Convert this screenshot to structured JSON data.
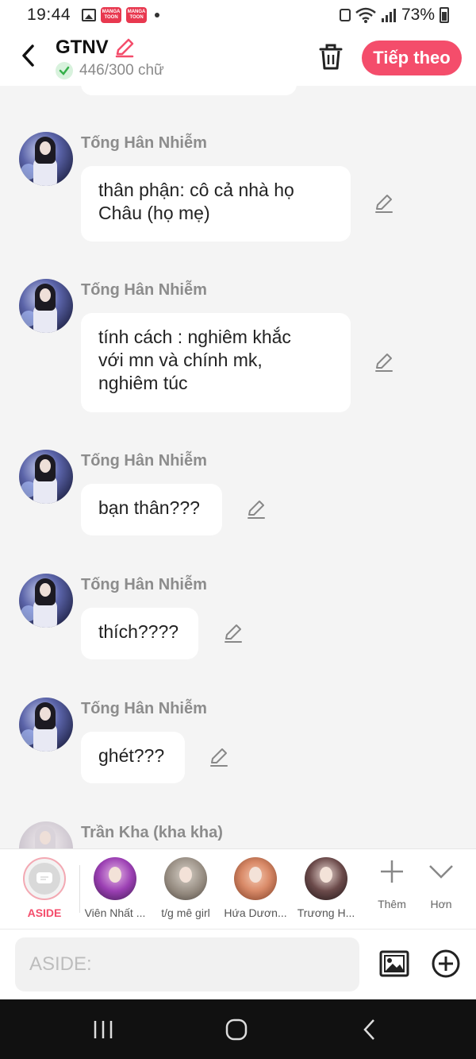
{
  "status_bar": {
    "time": "19:44",
    "battery": "73%",
    "manga_badge": "MANGA TOON"
  },
  "header": {
    "title": "GTNV",
    "word_count": "446/300 chữ",
    "next_label": "Tiếp theo"
  },
  "messages": [
    {
      "name": "Tống Hân Nhiễm",
      "lines": [
        "thân phận: cô cả nhà họ",
        "Châu (họ mẹ)"
      ]
    },
    {
      "name": "Tống Hân Nhiễm",
      "lines": [
        "tính cách : nghiêm khắc",
        "với mn và chính mk,",
        "nghiêm túc"
      ]
    },
    {
      "name": "Tống Hân Nhiễm",
      "lines": [
        "bạn thân???"
      ]
    },
    {
      "name": "Tống Hân Nhiễm",
      "lines": [
        "thích????"
      ]
    },
    {
      "name": "Tống Hân Nhiễm",
      "lines": [
        "ghét???"
      ]
    },
    {
      "name": "Trần Kha (kha kha)",
      "lines": []
    }
  ],
  "characters": [
    {
      "label": "ASIDE"
    },
    {
      "label": "Viên Nhất ..."
    },
    {
      "label": "t/g mê girl"
    },
    {
      "label": "Hứa Dươn..."
    },
    {
      "label": "Trương H..."
    }
  ],
  "tools": {
    "add_label": "Thêm",
    "more_label": "Hơn"
  },
  "input": {
    "placeholder": "ASIDE:"
  },
  "colors": {
    "accent": "#f44d6b",
    "check_green": "#35b04a"
  }
}
